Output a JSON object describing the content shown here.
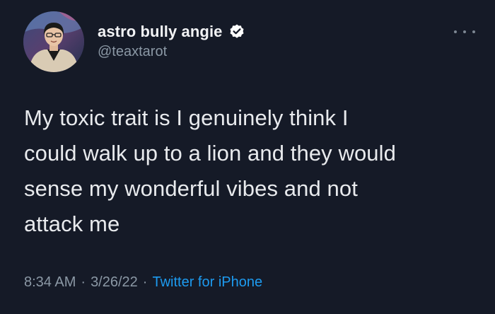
{
  "user": {
    "display_name": "astro bully angie",
    "handle": "@teaxtarot",
    "verified": true,
    "avatar_icon": "profile-photo"
  },
  "tweet": {
    "text": "My toxic trait is I genuinely think I\ncould walk up to a lion and they would\nsense my wonderful vibes and not\nattack me",
    "time": "8:34 AM",
    "date": "3/26/22",
    "source": "Twitter for iPhone",
    "separator": "·"
  },
  "colors": {
    "background": "#151a27",
    "text": "#e8eaed",
    "secondary": "#8b98a5",
    "accent": "#1d9bf0"
  },
  "icons": {
    "verified": "verified-badge-icon",
    "more": "more-options-icon"
  }
}
